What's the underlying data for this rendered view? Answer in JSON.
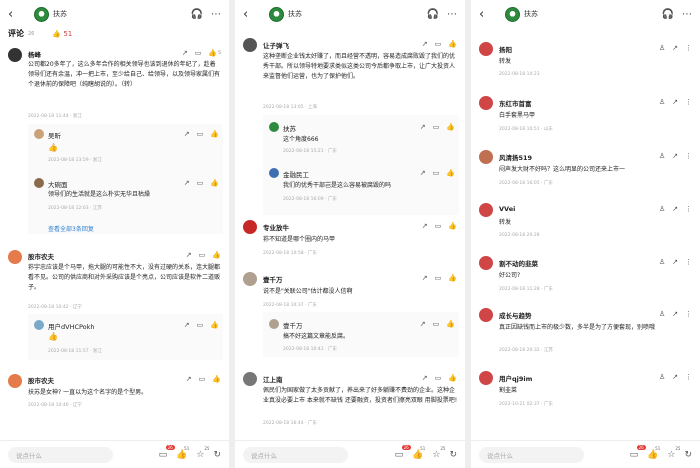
{
  "header": {
    "back": "‹",
    "name": "扶苏"
  },
  "panel1": {
    "tab_comments": "评论",
    "comment_count": "26",
    "tab_likes": "51",
    "comments": [
      {
        "name": "杨峰",
        "likes": "5",
        "text": "公司都20多年了，这么多年合作的相关领导也该到退休的年纪了，趁着领导们还有余温，冲一把上市，至少给自己、给领导，以及领导家属们有个退休前的保障吧（纯瞎胡说的）。（转）",
        "meta": "2022-08-18 11:44 · 浙江"
      },
      {
        "name": "吴昕",
        "text": "👍",
        "meta": "2022-08-18 13:59 · 浙江"
      },
      {
        "name": "大碗面",
        "text": "领导们的生活就是这么朴实无华且枯燥",
        "meta": "2022-08-18 12:03 · 江苏"
      },
      {
        "name": "股市农夫",
        "text": "荪宇忠应该是个马甲，拖大腿的可能性不大，没有过硬的关系，连大腿都看不见。公司的供应商和对外采购应该是个亮点，公司应该是软件二道贩子。",
        "meta": "2022-08-18 10:42 · 辽宁"
      },
      {
        "name": "用户dVHCPokh",
        "text": "👍",
        "meta": "2022-08-18 11:57 · 浙江"
      },
      {
        "name": "股市农夫",
        "text": "扶苏是女神? 一直以为这个名字的是个型男。",
        "meta": "2022-08-18 10:46 · 辽宁"
      }
    ],
    "more": "查看全部3条回复"
  },
  "panel2": {
    "comments": [
      {
        "name": "让子弹飞",
        "text": "这种垄断企业钱太好赚了，而且经营不透明，容易造成腐败毁了我们的优秀干部。所以领导特地要求类似这类公司今后都争取上市，让广大投资人来监督他们运营，也为了保护他们。",
        "meta": "2022-08-18 13:05 · 上海"
      },
      {
        "name": "扶苏",
        "text": "这个角度666",
        "meta": "2022-08-18 15:21 · 广东"
      },
      {
        "name": "金融民工",
        "text": "我们的优秀干部岂是这么容易被腐毁的吗",
        "meta": "2022-08-18 16:09 · 广东"
      },
      {
        "name": "专业放牛",
        "text": "荪不知道是哪个圈内的马甲",
        "meta": "2022-08-18 10:58 · 广东"
      },
      {
        "name": "壹千万",
        "text": "说不是\"关联公司\"估计都没人信啊",
        "meta": "2022-08-18 10:37 · 广东"
      },
      {
        "name": "壹千万",
        "text": "搞不好这篇文章能反腐。",
        "meta": "2022-08-18 10:41 · 广东"
      },
      {
        "name": "江上南",
        "text": "佩民们为国家做了太多贡献了，养出来了好多躺赚不费劲的企业。这种企业真没必要上市 本来就不缺钱 还要融资，投资者们擦亮双眼 用脚投票吧!",
        "meta": "2022-08-18 16:44 · 广东"
      }
    ]
  },
  "panel3": {
    "comments": [
      {
        "name": "扬阳",
        "text": "转发",
        "meta": "2022-08-18 14:23"
      },
      {
        "name": "东红市首富",
        "text": "白手套黑马甲",
        "meta": "2022-08-18 10:51 · 山东"
      },
      {
        "name": "风清扬519",
        "text": "闷声发大财不好吗？这么明显的公司还来上市一",
        "meta": "2022-08-18 16:05 · 广东"
      },
      {
        "name": "VVei",
        "text": "转发",
        "meta": "2022-08-18 20:28"
      },
      {
        "name": "割不动的韭菜",
        "text": "好公司?",
        "meta": "2022-08-18 11:28 · 广东"
      },
      {
        "name": "成长与趋势",
        "text": "真正因缺钱而上市的极少数，多半是为了方便套现，别喷哦",
        "meta": "2022-08-18 20:32 · 江苏"
      },
      {
        "name": "用户qj9im",
        "text": "割韭菜",
        "meta": "2022-10-21 02:37 · 广东"
      }
    ]
  },
  "bottom": {
    "placeholder": "说点什么",
    "likes": "51",
    "stars": "25"
  },
  "icons": {
    "share": "↗",
    "comment": "▭",
    "like": "👍",
    "reply": "♙",
    "menu": "⋮",
    "star": "☆"
  },
  "colors": {
    "link": "#2f7fd1",
    "badge": "#e53935"
  }
}
